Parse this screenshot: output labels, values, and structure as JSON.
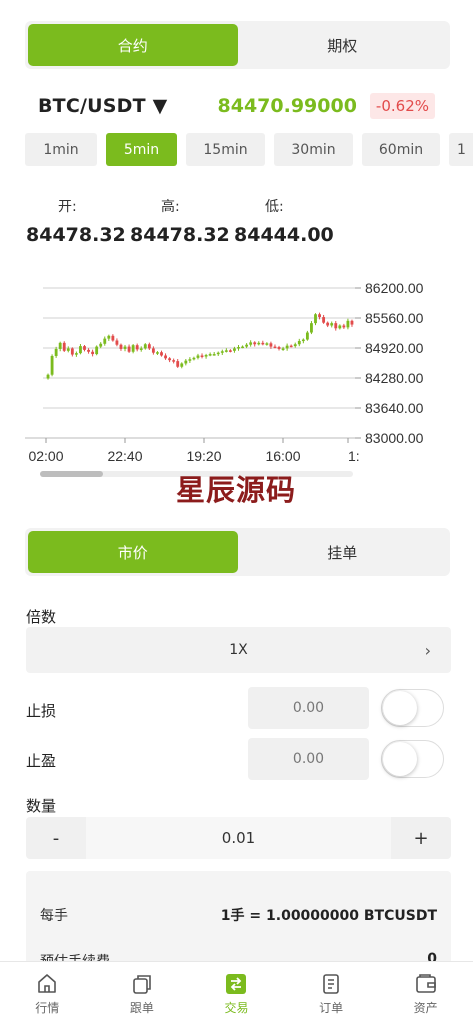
{
  "top_tabs": [
    {
      "label": "合约",
      "active": true
    },
    {
      "label": "期权",
      "active": false
    }
  ],
  "pair": "BTC/USDT ▼",
  "price": "84470.99000",
  "change": "-0.62%",
  "colors": {
    "accent": "#7bbb1e",
    "down": "#e24b4b",
    "up": "#7bbb1e",
    "watermark": "#8c1c1c"
  },
  "intervals": [
    {
      "label": "1min",
      "active": false
    },
    {
      "label": "5min",
      "active": true
    },
    {
      "label": "15min",
      "active": false
    },
    {
      "label": "30min",
      "active": false
    },
    {
      "label": "60min",
      "active": false
    },
    {
      "label": "1",
      "active": false
    }
  ],
  "stats": {
    "open_label": "开:",
    "open_value": "84478.32",
    "high_label": "高:",
    "high_value": "84478.32",
    "low_label": "低:",
    "low_value": "84444.00"
  },
  "chart_data": {
    "type": "candlestick",
    "y_axis_position": "right",
    "ylim": [
      83000,
      86200
    ],
    "y_ticks": [
      "86200.00",
      "85560.00",
      "84920.00",
      "84280.00",
      "83640.00",
      "83000.00"
    ],
    "x_ticks": [
      "02:00",
      "22:40",
      "19:20",
      "16:00",
      "1:"
    ],
    "grid": "horizontal",
    "closes": [
      84350,
      84750,
      84900,
      85030,
      84860,
      84910,
      84780,
      84810,
      84960,
      84880,
      84840,
      84790,
      84950,
      85010,
      85120,
      85180,
      85080,
      84990,
      84900,
      84950,
      84840,
      84980,
      84890,
      84910,
      85000,
      84910,
      84820,
      84830,
      84760,
      84700,
      84660,
      84640,
      84520,
      84590,
      84650,
      84680,
      84710,
      84760,
      84740,
      84770,
      84790,
      84790,
      84820,
      84850,
      84870,
      84860,
      84910,
      84940,
      84950,
      84990,
      85040,
      85000,
      85030,
      85010,
      85020,
      84950,
      84940,
      84900,
      84910,
      84970,
      84960,
      85000,
      85070,
      85100,
      85250,
      85450,
      85640,
      85580,
      85460,
      85400,
      85450,
      85340,
      85400,
      85360,
      85500,
      85420
    ]
  },
  "watermark": "星辰源码",
  "order_tabs": [
    {
      "label": "市价",
      "active": true
    },
    {
      "label": "挂单",
      "active": false
    }
  ],
  "form": {
    "multiplier_label": "倍数",
    "multiplier_value": "1X",
    "multiplier_arrow": "›",
    "stop_loss_label": "止损",
    "stop_loss_placeholder": "0.00",
    "take_profit_label": "止盈",
    "take_profit_placeholder": "0.00",
    "quantity_label": "数量",
    "quantity_minus": "-",
    "quantity_value": "0.01",
    "quantity_plus": "+"
  },
  "info": {
    "per_lot_label": "每手",
    "per_lot_value": "1手 = 1.00000000 BTCUSDT",
    "fee_label": "预估手续费",
    "fee_value": "0"
  },
  "bottom_nav": [
    {
      "label": "行情",
      "icon": "home-icon",
      "active": false
    },
    {
      "label": "跟单",
      "icon": "copy-icon",
      "active": false
    },
    {
      "label": "交易",
      "icon": "exchange-icon",
      "active": true
    },
    {
      "label": "订单",
      "icon": "document-icon",
      "active": false
    },
    {
      "label": "资产",
      "icon": "wallet-icon",
      "active": false
    }
  ]
}
